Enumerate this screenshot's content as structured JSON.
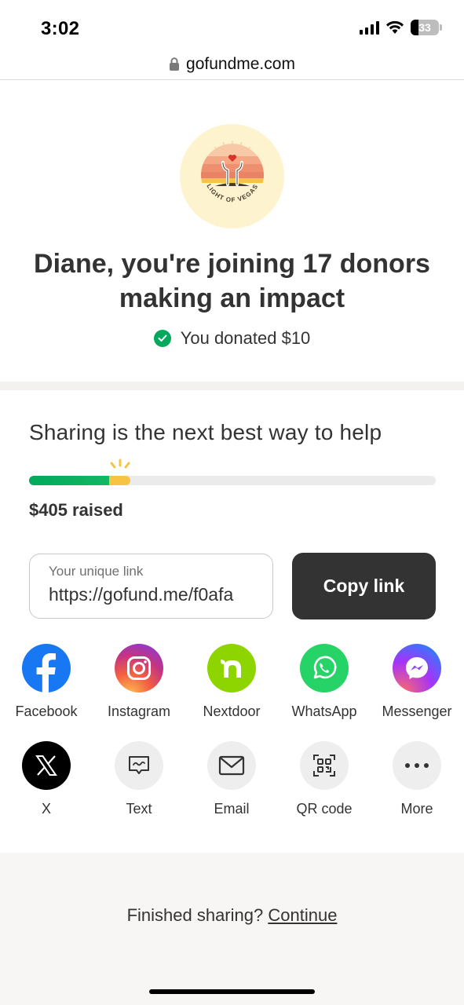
{
  "status_bar": {
    "time": "3:02",
    "battery": "33"
  },
  "browser": {
    "url": "gofundme.com"
  },
  "logo": {
    "text": "LIGHT OF VEGAS"
  },
  "headline": "Diane, you're joining 17 donors making an impact",
  "donation": {
    "text": "You donated $10"
  },
  "share": {
    "title": "Sharing is the next best way to help",
    "progress_fraction": 0.25,
    "raised": "$405 raised",
    "link_label": "Your unique link",
    "link_value": "https://gofund.me/f0afa",
    "copy_label": "Copy link"
  },
  "share_options": [
    {
      "label": "Facebook",
      "icon": "facebook-icon",
      "color": "#1877f2"
    },
    {
      "label": "Instagram",
      "icon": "instagram-icon",
      "color": "#e1306c"
    },
    {
      "label": "Nextdoor",
      "icon": "nextdoor-icon",
      "color": "#8ed500"
    },
    {
      "label": "WhatsApp",
      "icon": "whatsapp-icon",
      "color": "#25d366"
    },
    {
      "label": "Messenger",
      "icon": "messenger-icon",
      "color": "#a033ff"
    },
    {
      "label": "X",
      "icon": "x-icon",
      "color": "#000000"
    },
    {
      "label": "Text",
      "icon": "message-icon",
      "color": "#eeeeee"
    },
    {
      "label": "Email",
      "icon": "envelope-icon",
      "color": "#eeeeee"
    },
    {
      "label": "QR code",
      "icon": "qr-code-icon",
      "color": "#eeeeee"
    },
    {
      "label": "More",
      "icon": "more-dots-icon",
      "color": "#eeeeee"
    }
  ],
  "footer": {
    "prompt": "Finished sharing?",
    "link": "Continue"
  },
  "colors": {
    "accent_green": "#02a95c",
    "dark_button": "#333333",
    "progress_yellow": "#f6c343"
  }
}
